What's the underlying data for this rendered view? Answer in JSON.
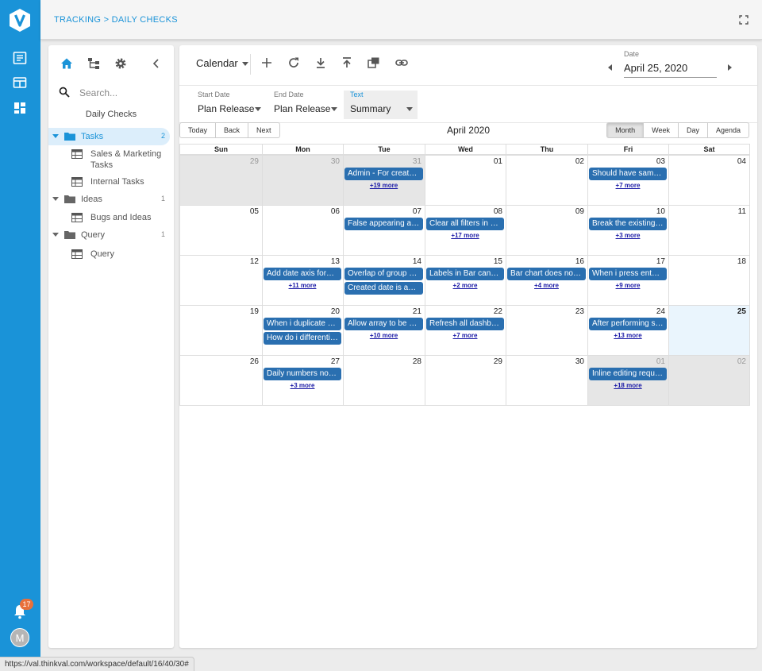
{
  "colors": {
    "brand": "#1a93d8",
    "event": "#2a6fb0",
    "notification": "#e8703a"
  },
  "rail": {
    "logo_icon": "v-logo-icon",
    "items": [
      "dashboard-icon",
      "layout-icon",
      "grid-icon"
    ],
    "notification_count": "17",
    "avatar_initial": "M"
  },
  "header": {
    "breadcrumb": "TRACKING > DAILY CHECKS",
    "expand_icon": "expand-icon"
  },
  "sidebar": {
    "icons": [
      "home-icon",
      "hierarchy-icon",
      "gear-icon",
      "chevron-left-icon"
    ],
    "search_placeholder": "Search...",
    "title": "Daily Checks",
    "tree": [
      {
        "label": "Tasks",
        "count": "2",
        "selected": true,
        "children": [
          "Sales & Marketing Tasks",
          "Internal Tasks"
        ]
      },
      {
        "label": "Ideas",
        "count": "1",
        "selected": false,
        "children": [
          "Bugs and Ideas"
        ]
      },
      {
        "label": "Query",
        "count": "1",
        "selected": false,
        "children": [
          "Query"
        ]
      }
    ]
  },
  "toolbar": {
    "view_label": "Calendar",
    "icons": [
      "add-icon",
      "refresh-icon",
      "download-icon",
      "upload-icon",
      "copy-icon",
      "link-icon"
    ],
    "date_label": "Date",
    "date_value": "April 25, 2020"
  },
  "filters": [
    {
      "label": "Start Date",
      "value": "Plan Release"
    },
    {
      "label": "End Date",
      "value": "Plan Release"
    },
    {
      "label": "Text",
      "value": "Summary"
    }
  ],
  "calendar": {
    "nav": [
      "Today",
      "Back",
      "Next"
    ],
    "title": "April 2020",
    "views": [
      "Month",
      "Week",
      "Day",
      "Agenda"
    ],
    "active_view": "Month",
    "weekdays": [
      "Sun",
      "Mon",
      "Tue",
      "Wed",
      "Thu",
      "Fri",
      "Sat"
    ],
    "weeks": [
      {
        "days": [
          "29",
          "30",
          "31",
          "01",
          "02",
          "03",
          "04"
        ],
        "off": [
          0,
          1,
          2
        ],
        "today": -1,
        "events": [
          {
            "day": 2,
            "text": "Admin - For create …"
          },
          {
            "day": 5,
            "text": "Should have same …"
          }
        ],
        "more": [
          {
            "day": 2,
            "text": "+19 more"
          },
          {
            "day": 5,
            "text": "+7 more"
          }
        ]
      },
      {
        "days": [
          "05",
          "06",
          "07",
          "08",
          "09",
          "10",
          "11"
        ],
        "off": [],
        "today": -1,
        "events": [
          {
            "day": 2,
            "text": "False appearing as …"
          },
          {
            "day": 3,
            "text": "Clear all filters in gr…"
          },
          {
            "day": 5,
            "text": "Break the existing …"
          }
        ],
        "more": [
          {
            "day": 3,
            "text": "+17 more"
          },
          {
            "day": 5,
            "text": "+3 more"
          }
        ]
      },
      {
        "days": [
          "12",
          "13",
          "14",
          "15",
          "16",
          "17",
          "18"
        ],
        "off": [],
        "today": -1,
        "events": [
          {
            "day": 1,
            "text": "Add date axis form…"
          },
          {
            "day": 2,
            "text": "Overlap of group b…"
          },
          {
            "day": 2,
            "row": 1,
            "text": "Created date is app…"
          },
          {
            "day": 3,
            "text": "Labels in Bar cann…"
          },
          {
            "day": 4,
            "text": "Bar chart does not …"
          },
          {
            "day": 5,
            "text": "When i press enter …"
          }
        ],
        "more": [
          {
            "day": 1,
            "text": "+11 more"
          },
          {
            "day": 3,
            "text": "+2 more"
          },
          {
            "day": 4,
            "text": "+4 more"
          },
          {
            "day": 5,
            "text": "+9 more"
          }
        ]
      },
      {
        "days": [
          "19",
          "20",
          "21",
          "22",
          "23",
          "24",
          "25"
        ],
        "off": [],
        "today": 6,
        "events": [
          {
            "day": 1,
            "text": "When i duplicate a …"
          },
          {
            "day": 1,
            "row": 1,
            "text": "How do i differenti…"
          },
          {
            "day": 2,
            "text": "Allow array to be br…"
          },
          {
            "day": 3,
            "text": "Refresh all dashbo…"
          },
          {
            "day": 5,
            "text": "After performing s…"
          }
        ],
        "more": [
          {
            "day": 2,
            "text": "+10 more"
          },
          {
            "day": 3,
            "text": "+7 more"
          },
          {
            "day": 5,
            "text": "+13 more"
          }
        ]
      },
      {
        "days": [
          "26",
          "27",
          "28",
          "29",
          "30",
          "01",
          "02"
        ],
        "off": [
          5,
          6
        ],
        "today": -1,
        "events": [
          {
            "day": 1,
            "text": "Daily numbers not …"
          },
          {
            "day": 5,
            "text": "Inline editing request"
          }
        ],
        "more": [
          {
            "day": 1,
            "text": "+3 more"
          },
          {
            "day": 5,
            "text": "+18 more"
          }
        ]
      }
    ]
  },
  "statusbar": {
    "url": "https://val.thinkval.com/workspace/default/16/40/30#"
  }
}
